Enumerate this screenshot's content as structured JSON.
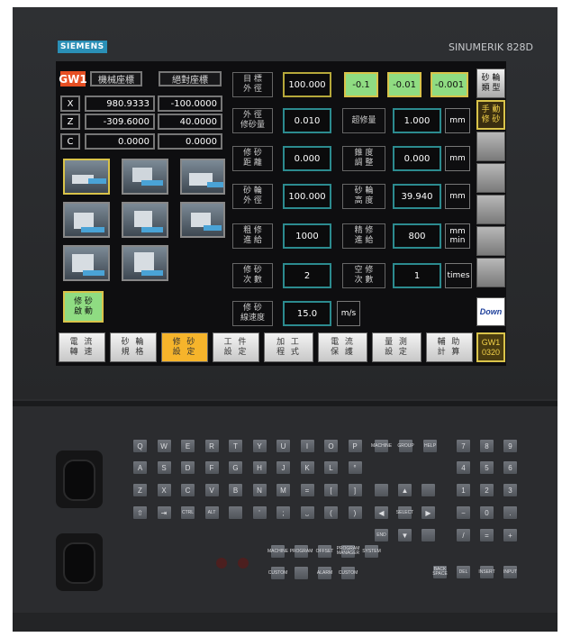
{
  "brand": {
    "logo": "SIEMENS",
    "model": "SINUMERIK 828D"
  },
  "coords": {
    "gw": "GW1",
    "machine_label": "機械座標",
    "absolute_label": "絕對座標",
    "rows": [
      {
        "axis": "X",
        "machine": "980.9333",
        "absolute": "-100.0000"
      },
      {
        "axis": "Z",
        "machine": "-309.6000",
        "absolute": "40.0000"
      },
      {
        "axis": "C",
        "machine": "0.0000",
        "absolute": "0.0000"
      }
    ]
  },
  "start_button": "修 砂\n啟 動",
  "params": {
    "target_dia": {
      "label": "目 標\n外 徑",
      "value": "100.000"
    },
    "steps": [
      "-0.1",
      "-0.01",
      "-0.001"
    ],
    "dress_feed": {
      "label": "外 徑\n修砂量",
      "value": "0.010"
    },
    "over_dress": {
      "label": "超修量",
      "value": "1.000",
      "unit": "mm"
    },
    "dress_dist": {
      "label": "修 砂\n距 離",
      "value": "0.000"
    },
    "taper_adj": {
      "label": "錐 度\n調 整",
      "value": "0.000",
      "unit": "mm"
    },
    "wheel_dia": {
      "label": "砂 輪\n外 徑",
      "value": "100.000"
    },
    "wheel_height": {
      "label": "砂 輪\n高 度",
      "value": "39.940",
      "unit": "mm"
    },
    "rough_feed": {
      "label": "粗 修\n進 給",
      "value": "1000"
    },
    "fine_feed": {
      "label": "精 修\n進 給",
      "value": "800",
      "unit": "mm\nmin"
    },
    "dress_count": {
      "label": "修 砂\n次 數",
      "value": "2"
    },
    "idle_count": {
      "label": "空 修\n次 數",
      "value": "1",
      "unit": "times"
    },
    "line_speed": {
      "label": "修 砂\n線速度",
      "value": "15.0",
      "unit": "m/s"
    }
  },
  "vsoft": [
    "砂 輪\n類 型",
    "手 動\n修 砂",
    "",
    "",
    "",
    "",
    ""
  ],
  "vsoft_logo": "Down",
  "hsoft": [
    "電 流\n轉 速",
    "砂 輪\n規 格",
    "修 砂\n設 定",
    "工 件\n設 定",
    "加 工\n程 式",
    "電 流\n保 護",
    "量 測\n設 定",
    "輔 助\n計 算"
  ],
  "hsoft_gw": "GW1\n0320",
  "keys": {
    "row1": [
      "Q",
      "W",
      "E",
      "R",
      "T",
      "Y",
      "U",
      "I",
      "O",
      "P"
    ],
    "row2": [
      "A",
      "S",
      "D",
      "F",
      "G",
      "H",
      "J",
      "K",
      "L",
      "°"
    ],
    "row3": [
      "Z",
      "X",
      "C",
      "V",
      "B",
      "N",
      "M",
      "=",
      "[",
      "]"
    ],
    "row4": [
      "⇧",
      "⇥",
      "CTRL",
      "ALT",
      "",
      "'",
      ";",
      "⎵",
      "(",
      ")"
    ],
    "num1": [
      "7",
      "8",
      "9"
    ],
    "num2": [
      "4",
      "5",
      "6"
    ],
    "num3": [
      "1",
      "2",
      "3"
    ],
    "num4": [
      "−",
      "0",
      "."
    ],
    "num5": [
      "/",
      "=",
      "+"
    ],
    "nav_top": [
      "MACHINE",
      "GROUP",
      "HELP"
    ],
    "select": "SELECT",
    "end": "END",
    "del": "DEL",
    "insert": "INSERT",
    "input": "INPUT",
    "backspace": "BACK SPACE",
    "func": [
      "MACHINE",
      "PROGRAM",
      "OFFSET",
      "PROGRAM MANAGER",
      "SYSTEM",
      "CUSTOM",
      "",
      "ALARM",
      "CUSTOM"
    ]
  }
}
